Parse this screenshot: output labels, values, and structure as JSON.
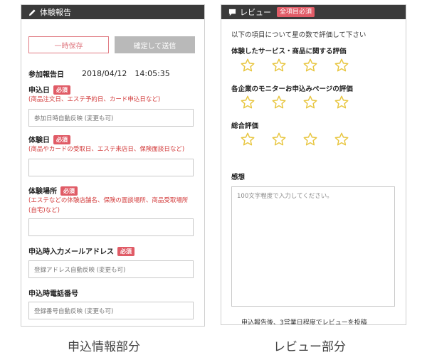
{
  "left": {
    "header_title": "体験報告",
    "save_label": "一時保存",
    "submit_label": "確定して送信",
    "report_date_label": "参加報告日",
    "report_date_value": "2018/04/12　14:05:35",
    "required": "必須",
    "apply_date": {
      "label": "申込日",
      "note": "(商品注文日、エステ予約日、カード申込日など)",
      "placeholder": "参加日時自動反映 (変更も可)"
    },
    "experience_date": {
      "label": "体験日",
      "note": "(商品やカードの受取日、エステ来店日、保険面談日など)",
      "placeholder": ""
    },
    "experience_place": {
      "label": "体験場所",
      "note": "(エステなどの体験店舗名、保険の面談場所、商品受取場所(自宅)など)",
      "placeholder": ""
    },
    "email": {
      "label": "申込時入力メールアドレス",
      "placeholder": "登録アドレス自動反映 (変更も可)"
    },
    "phone": {
      "label": "申込時電話番号",
      "placeholder": "登録番号自動反映 (変更も可)"
    }
  },
  "right": {
    "header_title": "レビュー",
    "header_badge": "全項目必須",
    "intro": "以下の項目について星の数で評価して下さい",
    "questions": [
      {
        "label": "体験したサービス・商品に関する評価",
        "rating": 0
      },
      {
        "label": "各企業のモニターお申込みページの評価",
        "rating": 0
      },
      {
        "label": "総合評価",
        "rating": 0
      }
    ],
    "impression_label": "感想",
    "impression_placeholder": "100文字程度で入力してください。",
    "footer_text": "申込報告後、3営業日程度でレビューを投稿"
  },
  "captions": {
    "left": "申込情報部分",
    "right": "レビュー部分"
  },
  "colors": {
    "header_bg": "#3a3a3a",
    "required_badge": "#e05b66",
    "star": "#e8c640",
    "note_text": "#d23a3a"
  },
  "icons": {
    "left_header": "pencil-icon",
    "right_header": "speech-bubble-icon"
  }
}
